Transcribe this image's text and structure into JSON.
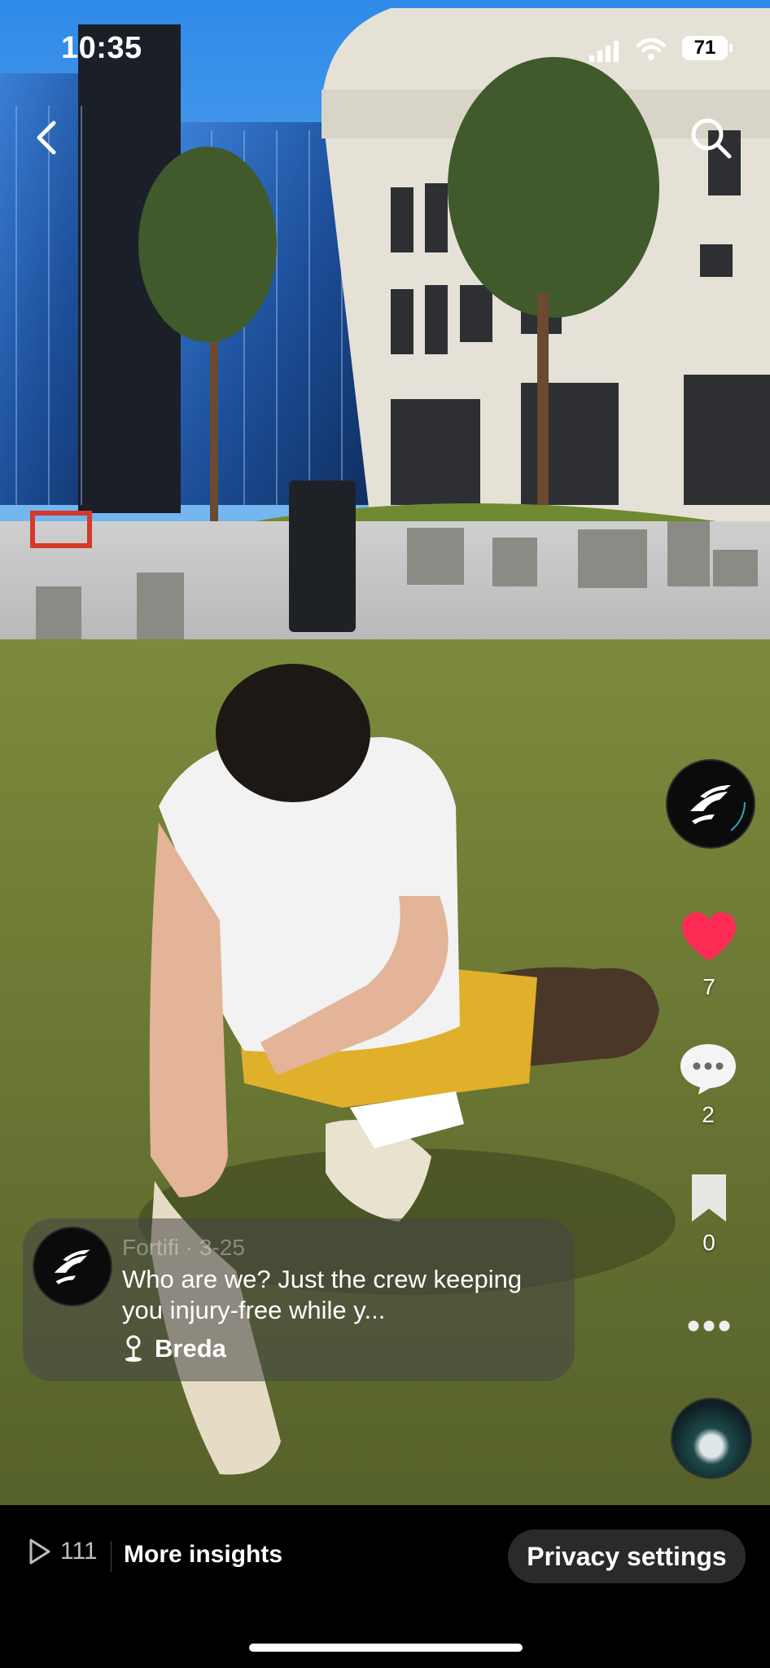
{
  "status_bar": {
    "time": "10:35",
    "battery": "71"
  },
  "post": {
    "author_partial": "Fortifi · 3-25",
    "caption": "Who are we? Just the crew keeping you injury-free while y...",
    "location": "Breda"
  },
  "actions": {
    "likes": "7",
    "comments": "2",
    "saves": "0"
  },
  "bottom_bar": {
    "views": "111",
    "insights_label": "More insights",
    "privacy_label": "Privacy settings"
  },
  "colors": {
    "like": "#fe2c55",
    "bottom_bg": "#000000",
    "pill_bg": "#2a2a2a"
  }
}
